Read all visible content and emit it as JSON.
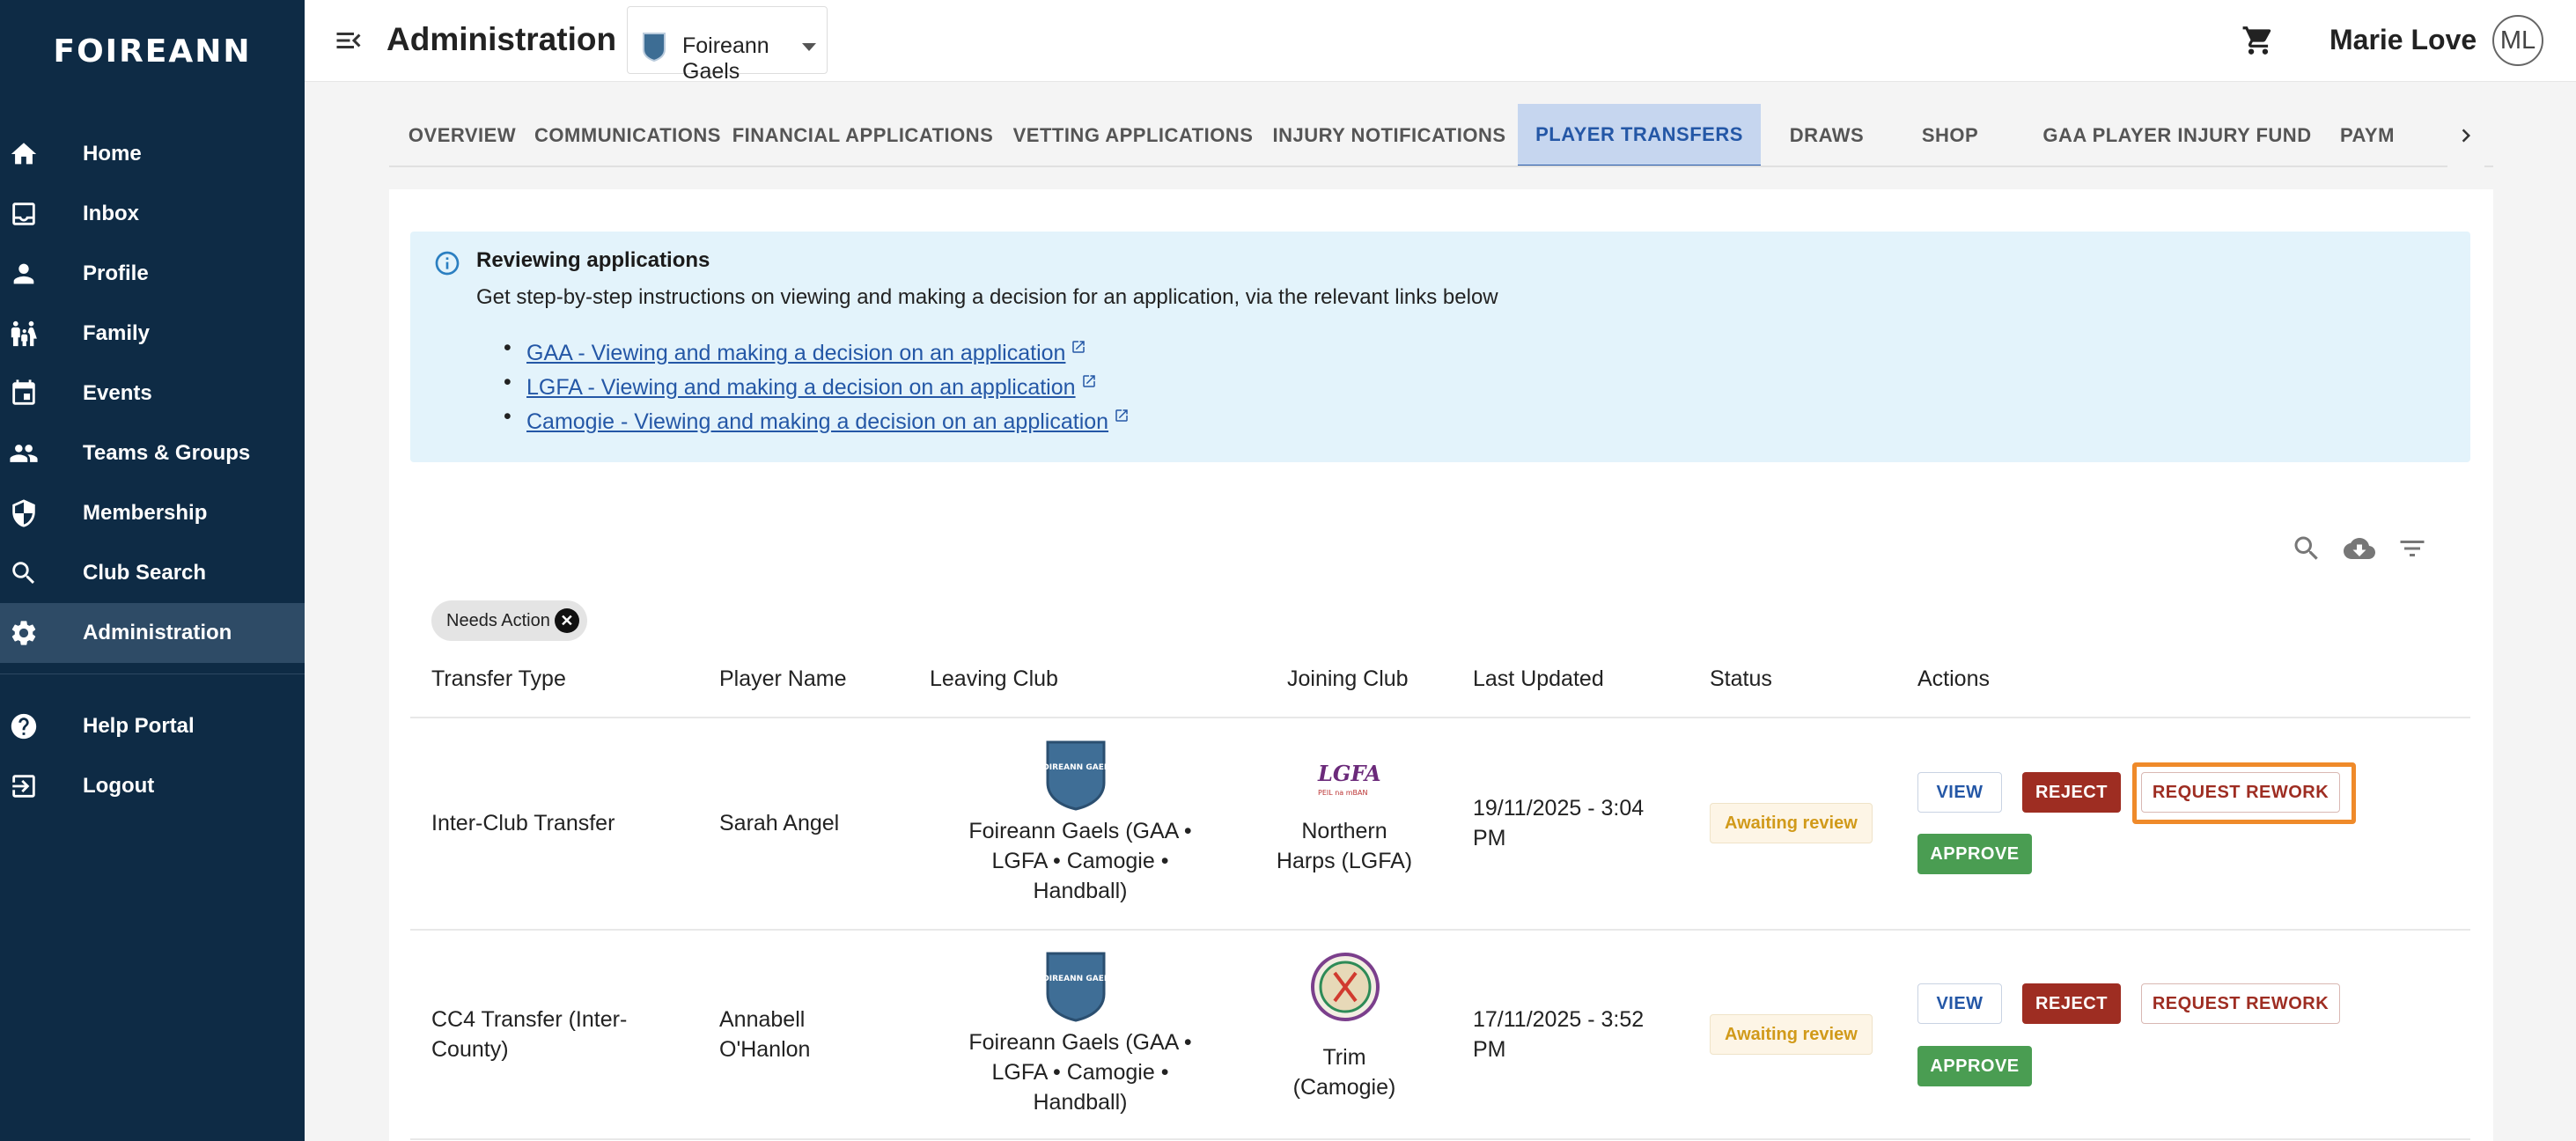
{
  "app": {
    "brand": "FOIREANN"
  },
  "sidebar": {
    "items": [
      {
        "label": "Home",
        "icon": "home-icon"
      },
      {
        "label": "Inbox",
        "icon": "inbox-icon"
      },
      {
        "label": "Profile",
        "icon": "person-icon"
      },
      {
        "label": "Family",
        "icon": "family-icon"
      },
      {
        "label": "Events",
        "icon": "calendar-icon"
      },
      {
        "label": "Teams & Groups",
        "icon": "group-icon"
      },
      {
        "label": "Membership",
        "icon": "shield-icon"
      },
      {
        "label": "Club Search",
        "icon": "search-icon"
      },
      {
        "label": "Administration",
        "icon": "gear-icon",
        "active": true
      }
    ],
    "footer_items": [
      {
        "label": "Help Portal",
        "icon": "help-icon"
      },
      {
        "label": "Logout",
        "icon": "logout-icon"
      }
    ]
  },
  "header": {
    "title": "Administration",
    "club_select": {
      "value": "Foireann Gaels"
    },
    "user_name": "Marie Love",
    "avatar_initials": "ML"
  },
  "tabs": [
    {
      "label": "OVERVIEW"
    },
    {
      "label": "COMMUNICATIONS"
    },
    {
      "label": "FINANCIAL APPLICATIONS"
    },
    {
      "label": "VETTING APPLICATIONS"
    },
    {
      "label": "INJURY NOTIFICATIONS"
    },
    {
      "label": "PLAYER TRANSFERS",
      "active": true
    },
    {
      "label": "DRAWS"
    },
    {
      "label": "SHOP"
    },
    {
      "label": "GAA PLAYER INJURY FUND"
    },
    {
      "label": "PAYM"
    }
  ],
  "info": {
    "title": "Reviewing applications",
    "description": "Get step-by-step instructions on viewing and making a decision for an application, via the relevant links below",
    "links": [
      {
        "label": "GAA - Viewing and making a decision on an application"
      },
      {
        "label": "LGFA - Viewing and making a decision on an application"
      },
      {
        "label": "Camogie - Viewing and making a decision on an application"
      }
    ]
  },
  "filter_chip": {
    "label": "Needs Action"
  },
  "table": {
    "headers": [
      "Transfer Type",
      "Player Name",
      "Leaving Club",
      "Joining Club",
      "Last Updated",
      "Status",
      "Actions"
    ],
    "rows": [
      {
        "transfer_type": "Inter-Club Transfer",
        "player_name": "Sarah Angel",
        "leaving_club": "Foireann Gaels (GAA • LGFA • Camogie • Handball)",
        "joining_club": "Northern Harps (LGFA)",
        "last_updated": "19/11/2025 - 3:04 PM",
        "status": "Awaiting review"
      },
      {
        "transfer_type": "CC4 Transfer (Inter-County)",
        "player_name": "Annabell O'Hanlon",
        "leaving_club": "Foireann Gaels (GAA • LGFA • Camogie • Handball)",
        "joining_club": "Trim (Camogie)",
        "last_updated": "17/11/2025 - 3:52 PM",
        "status": "Awaiting review"
      }
    ],
    "actions": {
      "view": "VIEW",
      "reject": "REJECT",
      "rework": "REQUEST REWORK",
      "approve": "APPROVE"
    }
  },
  "crest_text": "FOIREANN GAELS",
  "lgfa_logo_text": "LGFA",
  "lgfa_logo_subtext": "PEIL na mBAN",
  "colors": {
    "sidebar_bg": "#0e2b45",
    "active_tab": "#2457a6",
    "reject": "#9e2d22",
    "approve": "#4a9d52",
    "status": "#d19a1a",
    "highlight": "#ef8a2a"
  }
}
